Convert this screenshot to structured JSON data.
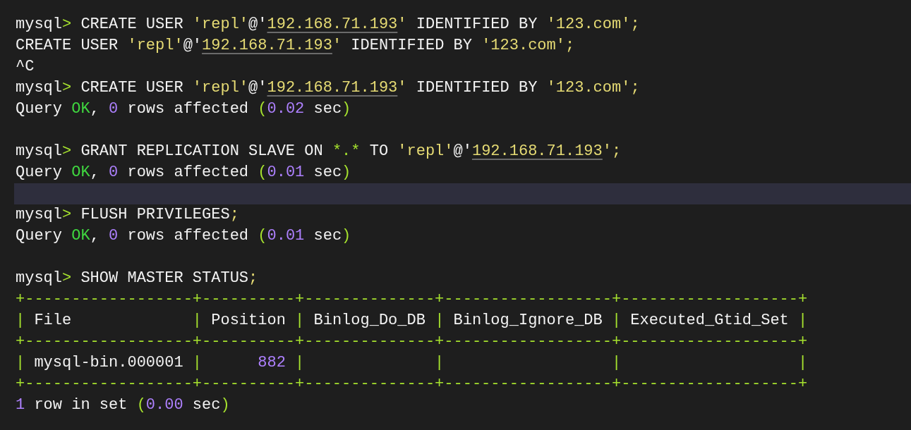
{
  "terminal": {
    "lines": [
      {
        "highlighted": false,
        "segments": [
          {
            "kind": "text",
            "text": "mysql"
          },
          {
            "kind": "prompt",
            "text": "> "
          },
          {
            "kind": "text",
            "text": "CREATE USER "
          },
          {
            "kind": "string",
            "text": "'repl'"
          },
          {
            "kind": "text",
            "text": "@'"
          },
          {
            "kind": "ip",
            "text": "192.168.71.193"
          },
          {
            "kind": "string",
            "text": "'"
          },
          {
            "kind": "text",
            "text": " IDENTIFIED BY "
          },
          {
            "kind": "string",
            "text": "'123.com';"
          }
        ]
      },
      {
        "highlighted": false,
        "segments": [
          {
            "kind": "text",
            "text": "CREATE USER "
          },
          {
            "kind": "string",
            "text": "'repl'"
          },
          {
            "kind": "text",
            "text": "@'"
          },
          {
            "kind": "ip",
            "text": "192.168.71.193"
          },
          {
            "kind": "string",
            "text": "'"
          },
          {
            "kind": "text",
            "text": " IDENTIFIED BY "
          },
          {
            "kind": "string",
            "text": "'123.com';"
          }
        ]
      },
      {
        "highlighted": false,
        "segments": [
          {
            "kind": "text",
            "text": "^C"
          }
        ]
      },
      {
        "highlighted": false,
        "segments": [
          {
            "kind": "text",
            "text": "mysql"
          },
          {
            "kind": "prompt",
            "text": "> "
          },
          {
            "kind": "text",
            "text": "CREATE USER "
          },
          {
            "kind": "string",
            "text": "'repl'"
          },
          {
            "kind": "text",
            "text": "@'"
          },
          {
            "kind": "ip",
            "text": "192.168.71.193"
          },
          {
            "kind": "string",
            "text": "'"
          },
          {
            "kind": "text",
            "text": " IDENTIFIED BY "
          },
          {
            "kind": "string",
            "text": "'123.com';"
          }
        ]
      },
      {
        "highlighted": false,
        "segments": [
          {
            "kind": "text",
            "text": "Query "
          },
          {
            "kind": "ok",
            "text": "OK"
          },
          {
            "kind": "text",
            "text": ", "
          },
          {
            "kind": "number",
            "text": "0"
          },
          {
            "kind": "text",
            "text": " rows affected "
          },
          {
            "kind": "paren",
            "text": "("
          },
          {
            "kind": "number",
            "text": "0.02"
          },
          {
            "kind": "text",
            "text": " sec"
          },
          {
            "kind": "paren",
            "text": ")"
          }
        ]
      },
      {
        "highlighted": false
      },
      {
        "highlighted": false,
        "segments": [
          {
            "kind": "text",
            "text": "mysql"
          },
          {
            "kind": "prompt",
            "text": "> "
          },
          {
            "kind": "text",
            "text": "GRANT REPLICATION SLAVE ON "
          },
          {
            "kind": "paren",
            "text": "*.*"
          },
          {
            "kind": "text",
            "text": " TO "
          },
          {
            "kind": "string",
            "text": "'repl'"
          },
          {
            "kind": "text",
            "text": "@'"
          },
          {
            "kind": "ip",
            "text": "192.168.71.193"
          },
          {
            "kind": "string",
            "text": "';"
          }
        ]
      },
      {
        "highlighted": false,
        "segments": [
          {
            "kind": "text",
            "text": "Query "
          },
          {
            "kind": "ok",
            "text": "OK"
          },
          {
            "kind": "text",
            "text": ", "
          },
          {
            "kind": "number",
            "text": "0"
          },
          {
            "kind": "text",
            "text": " rows affected "
          },
          {
            "kind": "paren",
            "text": "("
          },
          {
            "kind": "number",
            "text": "0.01"
          },
          {
            "kind": "text",
            "text": " sec"
          },
          {
            "kind": "paren",
            "text": ")"
          }
        ]
      },
      {
        "highlighted": true
      },
      {
        "highlighted": false,
        "segments": [
          {
            "kind": "text",
            "text": "mysql"
          },
          {
            "kind": "prompt",
            "text": "> "
          },
          {
            "kind": "text",
            "text": "FLUSH PRIVILEGES"
          },
          {
            "kind": "string",
            "text": ";"
          }
        ]
      },
      {
        "highlighted": false,
        "segments": [
          {
            "kind": "text",
            "text": "Query "
          },
          {
            "kind": "ok",
            "text": "OK"
          },
          {
            "kind": "text",
            "text": ", "
          },
          {
            "kind": "number",
            "text": "0"
          },
          {
            "kind": "text",
            "text": " rows affected "
          },
          {
            "kind": "paren",
            "text": "("
          },
          {
            "kind": "number",
            "text": "0.01"
          },
          {
            "kind": "text",
            "text": " sec"
          },
          {
            "kind": "paren",
            "text": ")"
          }
        ]
      },
      {
        "highlighted": false
      },
      {
        "highlighted": false,
        "segments": [
          {
            "kind": "text",
            "text": "mysql"
          },
          {
            "kind": "prompt",
            "text": "> "
          },
          {
            "kind": "text",
            "text": "SHOW MASTER STATUS"
          },
          {
            "kind": "string",
            "text": ";"
          }
        ]
      },
      {
        "highlighted": false,
        "segments": [
          {
            "kind": "border",
            "text": "+------------------+----------+--------------+------------------+-------------------+"
          }
        ]
      },
      {
        "highlighted": false,
        "segments": [
          {
            "kind": "border",
            "text": "|"
          },
          {
            "kind": "text",
            "text": " File             "
          },
          {
            "kind": "border",
            "text": "|"
          },
          {
            "kind": "text",
            "text": " Position "
          },
          {
            "kind": "border",
            "text": "|"
          },
          {
            "kind": "text",
            "text": " Binlog_Do_DB "
          },
          {
            "kind": "border",
            "text": "|"
          },
          {
            "kind": "text",
            "text": " Binlog_Ignore_DB "
          },
          {
            "kind": "border",
            "text": "|"
          },
          {
            "kind": "text",
            "text": " Executed_Gtid_Set "
          },
          {
            "kind": "border",
            "text": "|"
          }
        ]
      },
      {
        "highlighted": false,
        "segments": [
          {
            "kind": "border",
            "text": "+------------------+----------+--------------+------------------+-------------------+"
          }
        ]
      },
      {
        "highlighted": false,
        "segments": [
          {
            "kind": "border",
            "text": "|"
          },
          {
            "kind": "text",
            "text": " mysql-bin.000001 "
          },
          {
            "kind": "border",
            "text": "|"
          },
          {
            "kind": "number",
            "text": "      882 "
          },
          {
            "kind": "border",
            "text": "|              |                  |                   |"
          }
        ]
      },
      {
        "highlighted": false,
        "segments": [
          {
            "kind": "border",
            "text": "+------------------+----------+--------------+------------------+-------------------+"
          }
        ]
      },
      {
        "highlighted": false,
        "segments": [
          {
            "kind": "number",
            "text": "1"
          },
          {
            "kind": "text",
            "text": " row in set "
          },
          {
            "kind": "paren",
            "text": "("
          },
          {
            "kind": "number",
            "text": "0.00"
          },
          {
            "kind": "text",
            "text": " sec"
          },
          {
            "kind": "paren",
            "text": ")"
          }
        ]
      }
    ]
  }
}
